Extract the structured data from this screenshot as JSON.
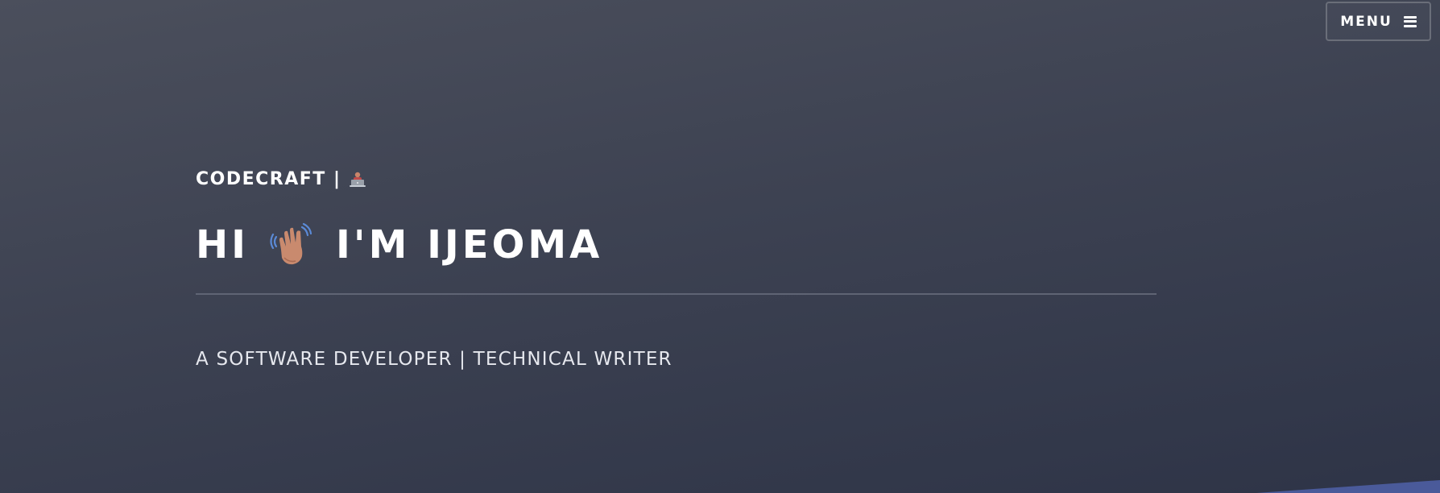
{
  "menu": {
    "label": "MENU",
    "icon": "hamburger-icon"
  },
  "hero": {
    "brand": "CODECRAFT |",
    "brand_icon": "laptop-person-icon",
    "greeting": "HI",
    "greeting_icon": "waving-hand-icon",
    "name": "I'M IJEOMA",
    "subtitle": "A SOFTWARE DEVELOPER | TECHNICAL WRITER"
  },
  "colors": {
    "background_top": "#4b4f5c",
    "background_bottom": "#2e3447",
    "accent": "#4a5a9a",
    "divider": "#5f6474"
  }
}
